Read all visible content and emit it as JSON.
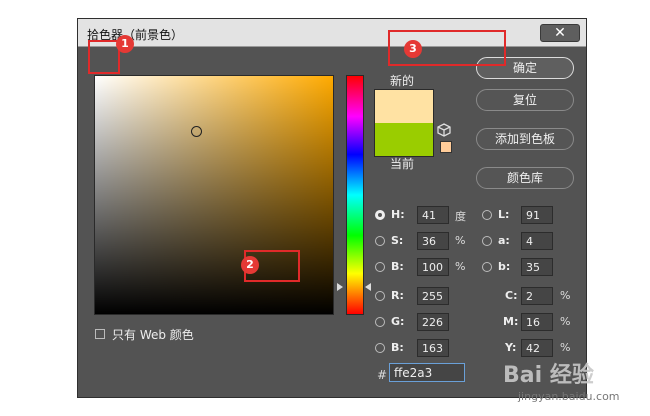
{
  "dialog": {
    "title": "拾色器（前景色）",
    "close_symbol": "✕"
  },
  "color_field": {
    "hue_color": "#ffaa00"
  },
  "hue_slider": {
    "level": 0.89
  },
  "preview": {
    "new_label": "新的",
    "current_label": "当前",
    "new_color": "#ffe2a3",
    "current_color": "#9acd00",
    "websafe_icon": "cube-icon",
    "websafe_color": "#ffcc99"
  },
  "buttons": {
    "ok": "确定",
    "reset": "复位",
    "add_to_swatches": "添加到色板",
    "color_libraries": "颜色库"
  },
  "hsb": [
    {
      "label": "H:",
      "value": "41",
      "unit": "度",
      "selected": true
    },
    {
      "label": "S:",
      "value": "36",
      "unit": "%",
      "selected": false
    },
    {
      "label": "B:",
      "value": "100",
      "unit": "%",
      "selected": false
    }
  ],
  "lab": [
    {
      "label": "L:",
      "value": "91"
    },
    {
      "label": "a:",
      "value": "4"
    },
    {
      "label": "b:",
      "value": "35"
    }
  ],
  "rgb": [
    {
      "label": "R:",
      "value": "255"
    },
    {
      "label": "G:",
      "value": "226"
    },
    {
      "label": "B:",
      "value": "163"
    }
  ],
  "cmyk": [
    {
      "label": "C:",
      "value": "2",
      "unit": "%"
    },
    {
      "label": "M:",
      "value": "16",
      "unit": "%"
    },
    {
      "label": "Y:",
      "value": "42",
      "unit": "%"
    }
  ],
  "hex": {
    "hash": "#",
    "value": "ffe2a3"
  },
  "web_only": {
    "label": "只有 Web 颜色"
  },
  "annotations": {
    "badge1": "1",
    "badge2": "2",
    "badge3": "3",
    "marker_color": "#e02a2a"
  },
  "watermark": {
    "logo": "Bai 经验",
    "url": "jingyan.baidu.com"
  }
}
